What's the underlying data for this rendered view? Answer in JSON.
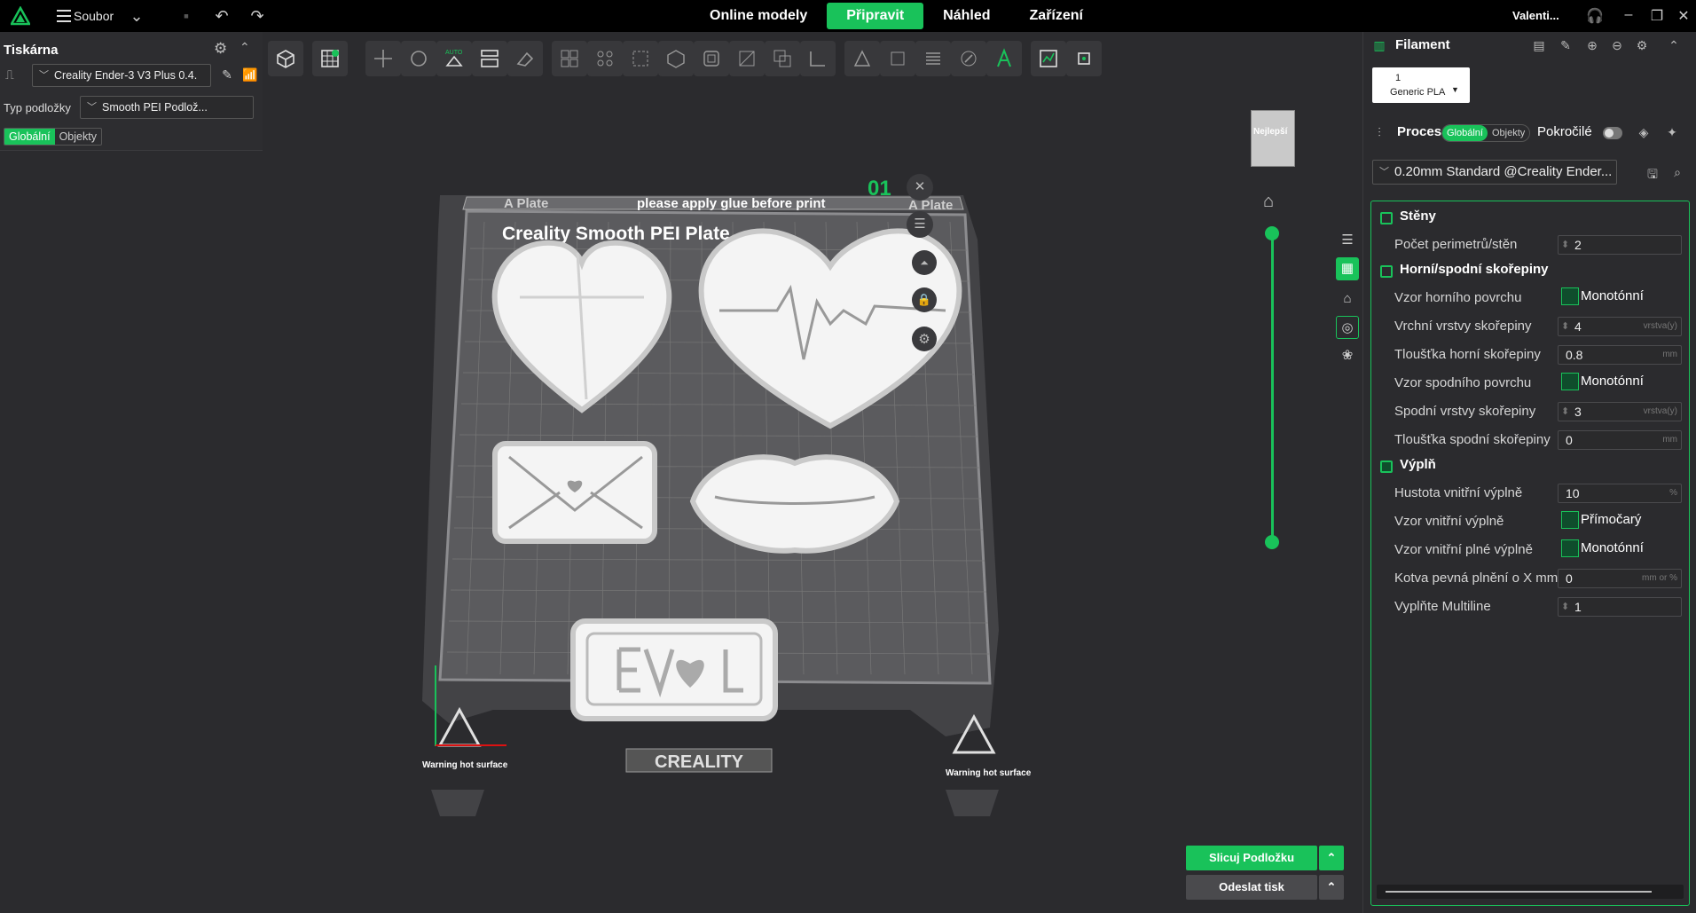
{
  "titlebar": {
    "menu_label": "Soubor",
    "tabs": [
      "Online modely",
      "Připravit",
      "Náhled",
      "Zařízení"
    ],
    "active_tab": "Připravit",
    "user": "Valenti..."
  },
  "left_panel": {
    "title": "Tiskárna",
    "printer": "Creality Ender-3 V3 Plus 0.4.",
    "plate_type_label": "Typ podložky",
    "plate_type": "Smooth PEI Podlož...",
    "scope_global": "Globální",
    "scope_objects": "Objekty"
  },
  "plate": {
    "name_left": "A Plate",
    "name_right": "A Plate",
    "glue_note": "please apply glue before print",
    "surface_label": "Creality Smooth PEI Plate",
    "number": "01",
    "brand": "CREALITY",
    "warning": "Warning hot surface"
  },
  "view_cube_label": "Nejlepší",
  "actions": {
    "slice": "Slicuj Podložku",
    "send": "Odeslat tisk"
  },
  "right_panel": {
    "filament_title": "Filament",
    "filament_slot": "1",
    "filament_name": "Generic PLA",
    "process_title": "Proces",
    "process_global": "Globální",
    "process_objects": "Objekty",
    "advanced_label": "Pokročilé",
    "preset": "0.20mm Standard @Creality Ender...",
    "sections": [
      {
        "title": "Stěny",
        "props": [
          {
            "label": "Počet perimetrů/stěn",
            "value": "2",
            "unit": ""
          }
        ]
      },
      {
        "title": "Horní/spodní skořepiny",
        "props": [
          {
            "label": "Vzor horního povrchu",
            "value": "Monotónní",
            "unit": ""
          },
          {
            "label": "Vrchní vrstvy skořepiny",
            "value": "4",
            "unit": "vrstva(y)"
          },
          {
            "label": "Tloušťka horní skořepiny",
            "value": "0.8",
            "unit": "mm"
          },
          {
            "label": "Vzor spodního povrchu",
            "value": "Monotónní",
            "unit": ""
          },
          {
            "label": "Spodní vrstvy skořepiny",
            "value": "3",
            "unit": "vrstva(y)"
          },
          {
            "label": "Tloušťka spodní skořepiny",
            "value": "0",
            "unit": "mm"
          }
        ]
      },
      {
        "title": "Výplň",
        "props": [
          {
            "label": "Hustota vnitřní výplně",
            "value": "10",
            "unit": "%"
          },
          {
            "label": "Vzor vnitřní výplně",
            "value": "Přímočarý",
            "unit": ""
          },
          {
            "label": "Vzor vnitřní plné výplně",
            "value": "Monotónní",
            "unit": ""
          },
          {
            "label": "Kotva pevná plnění o X mm",
            "value": "0",
            "unit": "mm or %"
          },
          {
            "label": "Vyplňte Multiline",
            "value": "1",
            "unit": ""
          }
        ]
      }
    ]
  },
  "colors": {
    "accent": "#19c25a",
    "background": "#2b2b2e",
    "titlebar": "#000000"
  }
}
